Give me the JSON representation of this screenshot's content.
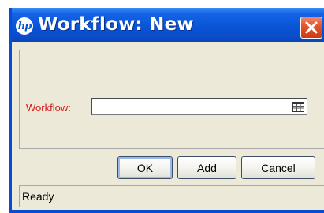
{
  "window": {
    "title": "Workflow: New",
    "logo_text": "hp",
    "title_bar_color": "#0a54d8",
    "close_button_color": "#e0532c"
  },
  "form": {
    "workflow_label": "Workflow:",
    "workflow_value": "",
    "label_color": "#d11a1a",
    "lookup_icon": "list-picker-icon"
  },
  "buttons": {
    "ok_label": "OK",
    "add_label": "Add",
    "cancel_label": "Cancel"
  },
  "status": {
    "text": "Ready"
  }
}
